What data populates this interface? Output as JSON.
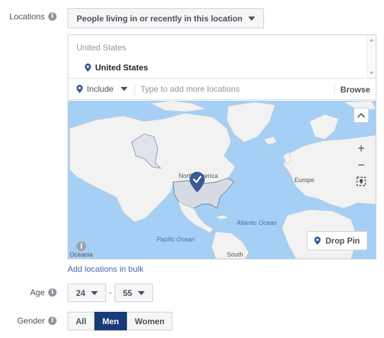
{
  "locations": {
    "label": "Locations",
    "dropdown_label": "People living in or recently in this location",
    "country_header": "United States",
    "selected": "United States",
    "include_label": "Include",
    "input_placeholder": "Type to add more locations",
    "browse_label": "Browse",
    "map": {
      "labels": {
        "north_america": "North America",
        "europe": "Europe",
        "atlantic": "Atlantic Ocean",
        "pacific": "Pacific Ocean",
        "south": "South",
        "oceania": "Oceania"
      },
      "drop_pin_label": "Drop Pin"
    },
    "bulk_link": "Add locations in bulk"
  },
  "age": {
    "label": "Age",
    "min": "24",
    "separator": "-",
    "max": "55"
  },
  "gender": {
    "label": "Gender",
    "options": [
      "All",
      "Men",
      "Women"
    ],
    "selected": "Men"
  },
  "colors": {
    "accent": "#4267b2",
    "selected_toggle": "#1a3b7a",
    "map_water": "#a6cff5",
    "map_land": "#f2f2f2",
    "pin": "#3b5998"
  }
}
